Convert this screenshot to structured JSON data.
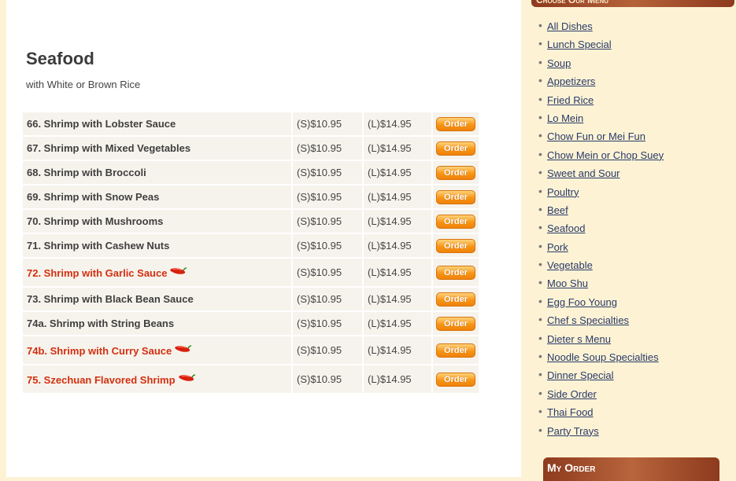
{
  "page": {
    "title": "Seafood",
    "subtitle": "with White or Brown Rice"
  },
  "menu": {
    "order_label": "Order",
    "items": [
      {
        "name": "66. Shrimp with Lobster Sauce",
        "small": "(S)$10.95",
        "large": "(L)$14.95",
        "spicy": false
      },
      {
        "name": "67. Shrimp with Mixed Vegetables",
        "small": "(S)$10.95",
        "large": "(L)$14.95",
        "spicy": false
      },
      {
        "name": "68. Shrimp with Broccoli",
        "small": "(S)$10.95",
        "large": "(L)$14.95",
        "spicy": false
      },
      {
        "name": "69. Shrimp with Snow Peas",
        "small": "(S)$10.95",
        "large": "(L)$14.95",
        "spicy": false
      },
      {
        "name": "70. Shrimp with Mushrooms",
        "small": "(S)$10.95",
        "large": "(L)$14.95",
        "spicy": false
      },
      {
        "name": "71. Shrimp with Cashew Nuts",
        "small": "(S)$10.95",
        "large": "(L)$14.95",
        "spicy": false
      },
      {
        "name": "72. Shrimp with Garlic Sauce",
        "small": "(S)$10.95",
        "large": "(L)$14.95",
        "spicy": true
      },
      {
        "name": "73. Shrimp with Black Bean Sauce",
        "small": "(S)$10.95",
        "large": "(L)$14.95",
        "spicy": false
      },
      {
        "name": "74a. Shrimp with String Beans",
        "small": "(S)$10.95",
        "large": "(L)$14.95",
        "spicy": false
      },
      {
        "name": "74b. Shrimp with Curry Sauce",
        "small": "(S)$10.95",
        "large": "(L)$14.95",
        "spicy": true
      },
      {
        "name": "75. Szechuan Flavored Shrimp",
        "small": "(S)$10.95",
        "large": "(L)$14.95",
        "spicy": true
      }
    ]
  },
  "sidebar": {
    "header": "Choose Our Menu",
    "categories": [
      "All Dishes",
      "Lunch Special",
      "Soup",
      "Appetizers",
      "Fried Rice",
      "Lo Mein",
      "Chow Fun or Mei Fun",
      "Chow Mein or Chop Suey",
      "Sweet and Sour",
      "Poultry",
      "Beef",
      "Seafood",
      "Pork",
      "Vegetable",
      "Moo Shu",
      "Egg Foo Young",
      "Chef s Specialties",
      "Dieter s Menu",
      "Noodle Soup Specialties",
      "Dinner Special",
      "Side Order",
      "Thai Food",
      "Party Trays"
    ],
    "my_order_header": "My Order"
  },
  "icons": {
    "spicy": "chili-pepper-icon",
    "bullet": "bullet-icon"
  },
  "colors": {
    "spicy_text": "#d32f10",
    "order_button": "#f79515",
    "header_bar": "#8d3a1e",
    "link": "#2a3a6a",
    "page_background": "#fdf3d4"
  }
}
